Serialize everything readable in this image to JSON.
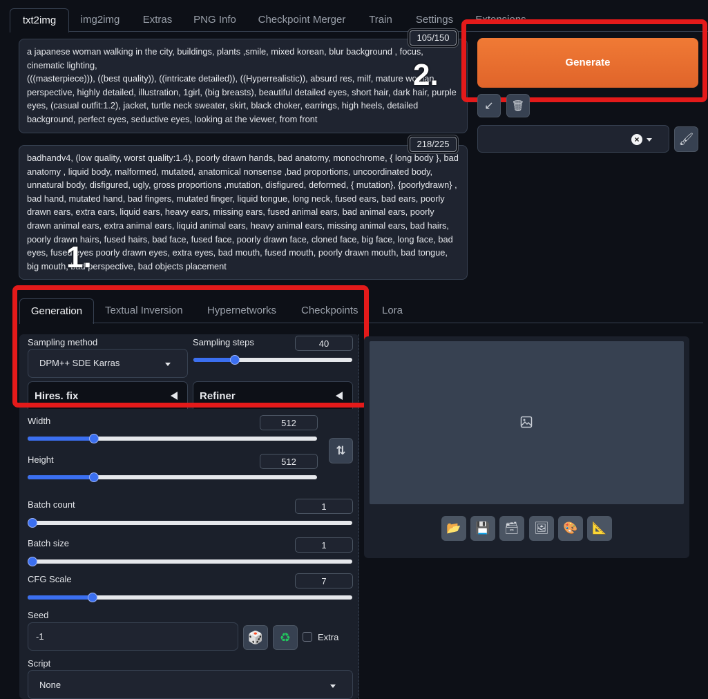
{
  "top_tabs": [
    "txt2img",
    "img2img",
    "Extras",
    "PNG Info",
    "Checkpoint Merger",
    "Train",
    "Settings",
    "Extensions"
  ],
  "prompt": {
    "text": "a japanese woman walking in the city, buildings, plants ,smile, mixed korean, blur background , focus, cinematic lighting,\n(((masterpiece))), ((best quality)), ((intricate detailed)), ((Hyperrealistic)), absurd res, milf, mature woman, perspective, highly detailed, illustration, 1girl, (big breasts), beautiful detailed eyes, short hair, dark hair, purple eyes, (casual outfit:1.2), jacket, turtle neck sweater, skirt, black choker, earrings, high heels, detailed background, perfect eyes, seductive eyes, looking at the viewer, from front",
    "counter": "105/150"
  },
  "negative_prompt": {
    "text": "badhandv4, (low quality, worst quality:1.4), poorly drawn hands, bad anatomy, monochrome, { long body }, bad anatomy , liquid body, malformed, mutated, anatomical nonsense ,bad proportions, uncoordinated body, unnatural body, disfigured, ugly, gross proportions ,mutation, disfigured, deformed, { mutation}, {poorlydrawn} , bad hand, mutated hand, bad fingers, mutated finger, liquid tongue, long neck, fused ears, bad ears, poorly drawn ears, extra ears, liquid ears, heavy ears, missing ears, fused animal ears, bad animal ears, poorly drawn animal ears, extra animal ears, liquid animal ears, heavy animal ears, missing animal ears, bad hairs, poorly drawn hairs, fused hairs, bad face, fused face, poorly drawn face, cloned face, big face, long face, bad eyes, fused eyes poorly drawn eyes, extra eyes, bad mouth, fused mouth, poorly drawn mouth, bad tongue, big mouth, bad perspective, bad objects placement",
    "counter": "218/225"
  },
  "generate_label": "Generate",
  "annotations": {
    "one": "1.",
    "two": "2."
  },
  "sub_tabs": [
    "Generation",
    "Textual Inversion",
    "Hypernetworks",
    "Checkpoints",
    "Lora"
  ],
  "sampling": {
    "method_label": "Sampling method",
    "method_value": "DPM++ SDE Karras",
    "steps_label": "Sampling steps",
    "steps_value": "40",
    "steps_fraction": 0.26
  },
  "accordions": {
    "hires": "Hires. fix",
    "refiner": "Refiner"
  },
  "width": {
    "label": "Width",
    "value": "512",
    "fraction": 0.23
  },
  "height": {
    "label": "Height",
    "value": "512",
    "fraction": 0.23
  },
  "batch_count": {
    "label": "Batch count",
    "value": "1",
    "fraction": 0.0
  },
  "batch_size": {
    "label": "Batch size",
    "value": "1",
    "fraction": 0.0
  },
  "cfg": {
    "label": "CFG Scale",
    "value": "7",
    "fraction": 0.2
  },
  "seed": {
    "label": "Seed",
    "value": "-1",
    "extra_label": "Extra"
  },
  "script": {
    "label": "Script",
    "value": "None"
  },
  "colors": {
    "accent": "#3b6ff0",
    "generate": "#e96c30",
    "annotation": "#e41a1a"
  }
}
